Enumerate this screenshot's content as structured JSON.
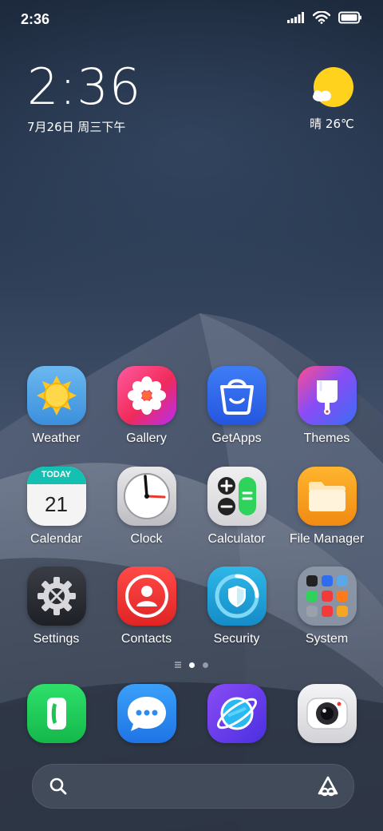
{
  "status_bar": {
    "time": "2:36",
    "icons": [
      "signal-icon",
      "wifi-icon",
      "battery-icon"
    ]
  },
  "clock_widget": {
    "time": "2:36",
    "date": "7月26日 周三下午"
  },
  "weather_widget": {
    "icon": "sun-cloud-icon",
    "text": "晴 26℃"
  },
  "apps": [
    {
      "label": "Weather",
      "icon": "weather-icon"
    },
    {
      "label": "Gallery",
      "icon": "gallery-icon"
    },
    {
      "label": "GetApps",
      "icon": "getapps-icon"
    },
    {
      "label": "Themes",
      "icon": "themes-icon"
    },
    {
      "label": "Calendar",
      "icon": "calendar-icon",
      "badge": "TODAY",
      "day": "21"
    },
    {
      "label": "Clock",
      "icon": "clock-icon"
    },
    {
      "label": "Calculator",
      "icon": "calculator-icon"
    },
    {
      "label": "File Manager",
      "icon": "file-manager-icon"
    },
    {
      "label": "Settings",
      "icon": "settings-icon"
    },
    {
      "label": "Contacts",
      "icon": "contacts-icon"
    },
    {
      "label": "Security",
      "icon": "security-icon"
    },
    {
      "label": "System",
      "icon": "system-folder-icon"
    }
  ],
  "page_indicator": {
    "pages": 2,
    "current": 1
  },
  "dock": [
    {
      "icon": "phone-icon"
    },
    {
      "icon": "messages-icon"
    },
    {
      "icon": "browser-icon"
    },
    {
      "icon": "camera-icon"
    }
  ],
  "search_bar": {
    "left_icon": "search-icon",
    "right_icon": "assistant-icon"
  },
  "colors": {
    "weather": "#5aa8e8",
    "gallery": "#ff3b7a",
    "getapps": "#2f6df0",
    "themes": "#4b6cf5",
    "calendar_top": "#13c0b2",
    "calc_green": "#2fd25a",
    "files": "#f5a623",
    "contacts": "#f23a3a",
    "security": "#1aa6d6",
    "phone": "#1fd05a",
    "messages": "#2b8cf2",
    "browser": "#6a3cf0"
  }
}
